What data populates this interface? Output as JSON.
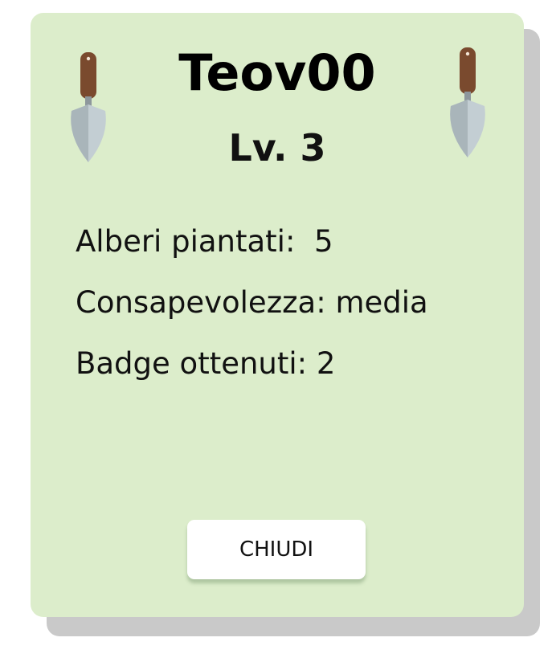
{
  "profile": {
    "username": "Teov00",
    "level": "Lv. 3"
  },
  "stats": [
    {
      "text": "Alberi piantati:  5"
    },
    {
      "text": "Consapevolezza: media"
    },
    {
      "text": "Badge ottenuti: 2"
    }
  ],
  "actions": {
    "close_label": "CHIUDI"
  },
  "decorations": {
    "left_icon": "trowel-icon",
    "right_icon": "trowel-icon"
  },
  "colors": {
    "card_background": "#dcedcb",
    "card_shadow": "#c9c9c9",
    "button_background": "#ffffff",
    "trowel_handle": "#7a4a2e",
    "trowel_blade": "#b9c6cb"
  }
}
